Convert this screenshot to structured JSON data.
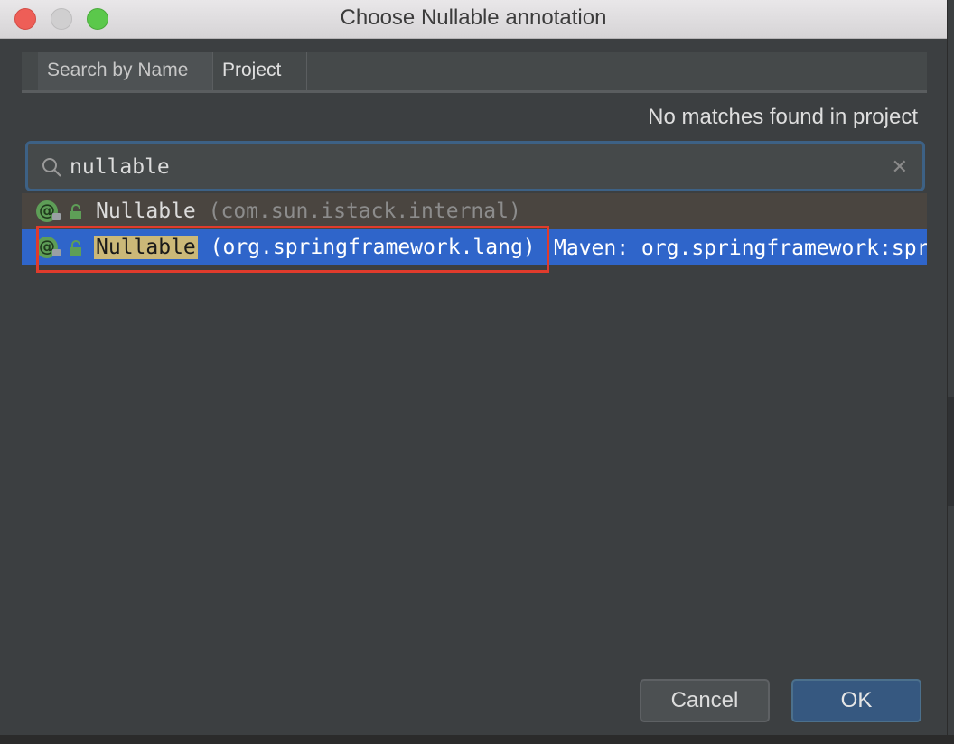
{
  "window": {
    "title": "Choose Nullable annotation"
  },
  "tabs": [
    {
      "label": "Search by Name",
      "active": true
    },
    {
      "label": "Project",
      "active": false
    }
  ],
  "status_text": "No matches found in project",
  "search": {
    "value": "nullable",
    "icon": "search-icon",
    "clear_icon": "✕"
  },
  "results": [
    {
      "icon_label": "@",
      "name": "Nullable",
      "package": " (com.sun.istack.internal)",
      "location": "",
      "selected": false
    },
    {
      "icon_label": "@",
      "name": "Nullable",
      "package": " (org.springframework.lang)",
      "location": "Maven: org.springframework:spring-core",
      "selected": true
    }
  ],
  "buttons": {
    "cancel": "Cancel",
    "ok": "OK"
  },
  "colors": {
    "selection": "#2f65ca",
    "highlight_box": "#e03b2c",
    "ok_button": "#365880"
  }
}
